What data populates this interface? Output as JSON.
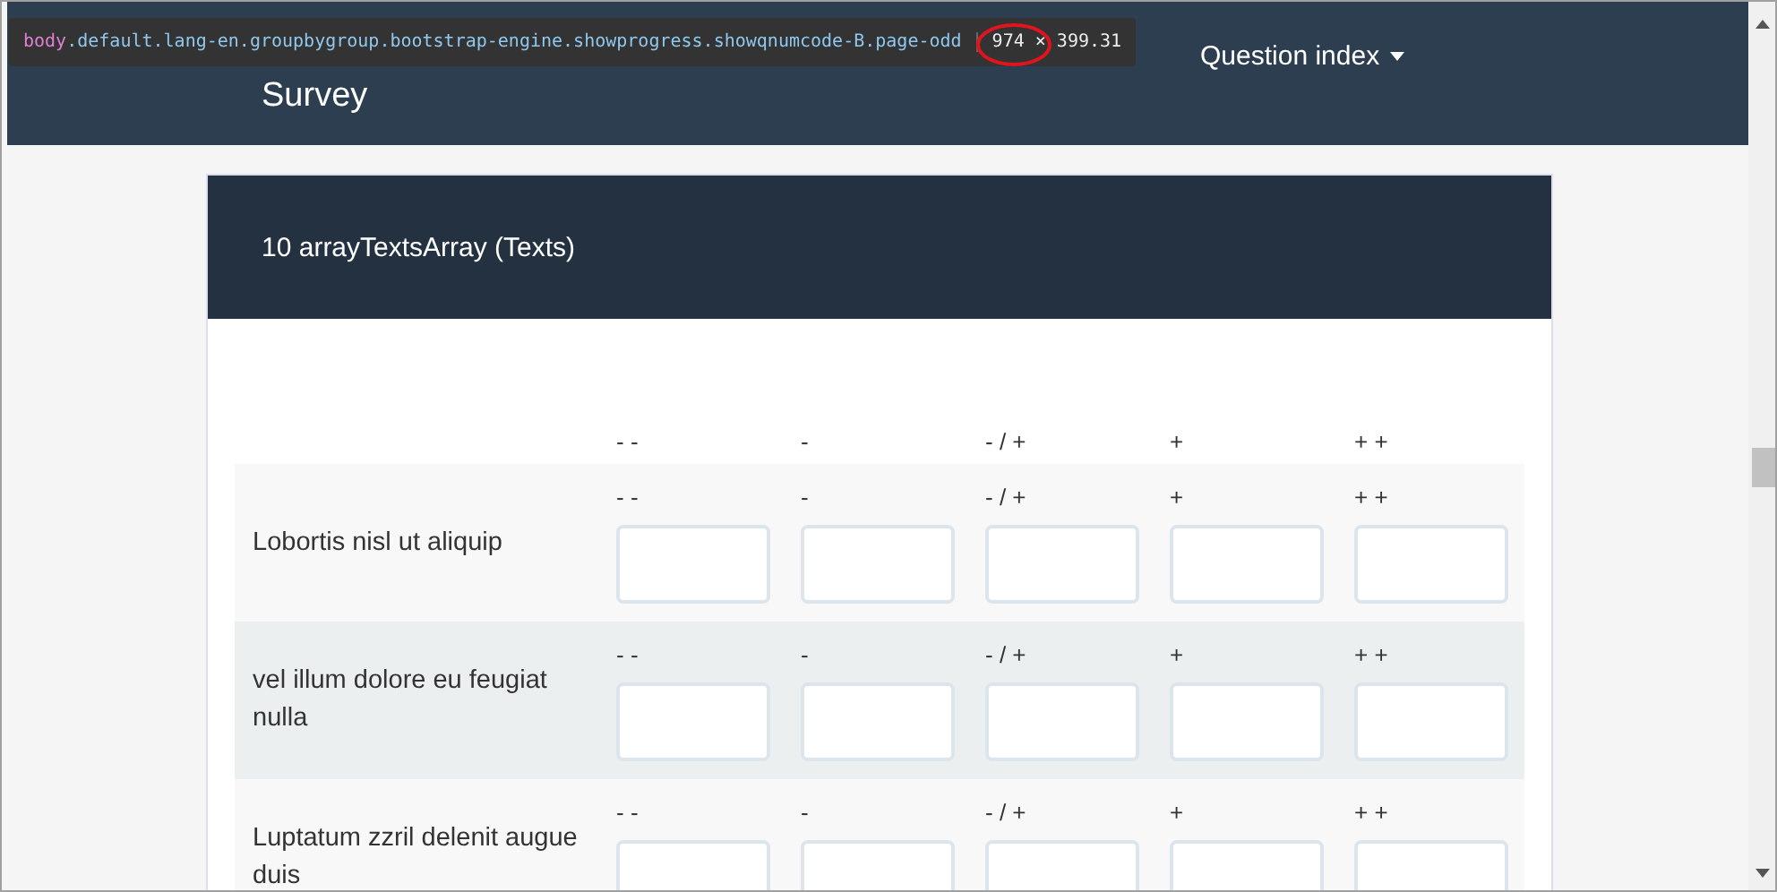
{
  "inspector_tooltip": {
    "selector_tag": "body",
    "selector_classes": ".default.lang-en.groupbygroup.bootstrap-engine.showprogress.showqnumcode-B.page-odd",
    "size": "974 × 399.31"
  },
  "header": {
    "title": "Survey",
    "nav": [
      {
        "label": "Question index",
        "kind": "dropdown"
      }
    ]
  },
  "question": {
    "title": "10 arrayTextsArray (Texts)",
    "columns": [
      "- -",
      "-",
      "- / +",
      "+",
      "+ +"
    ],
    "rows": [
      {
        "label": "Lobortis nisl ut aliquip",
        "cell_labels": [
          "- -",
          "-",
          "- / +",
          "+",
          "+ +"
        ]
      },
      {
        "label": "vel illum dolore eu feugiat nulla",
        "cell_labels": [
          "- -",
          "-",
          "- / +",
          "+",
          "+ +"
        ]
      },
      {
        "label": "Luptatum zzril delenit augue duis",
        "cell_labels": [
          "- -",
          "-",
          "- / +",
          "+",
          "+ +"
        ]
      }
    ]
  }
}
